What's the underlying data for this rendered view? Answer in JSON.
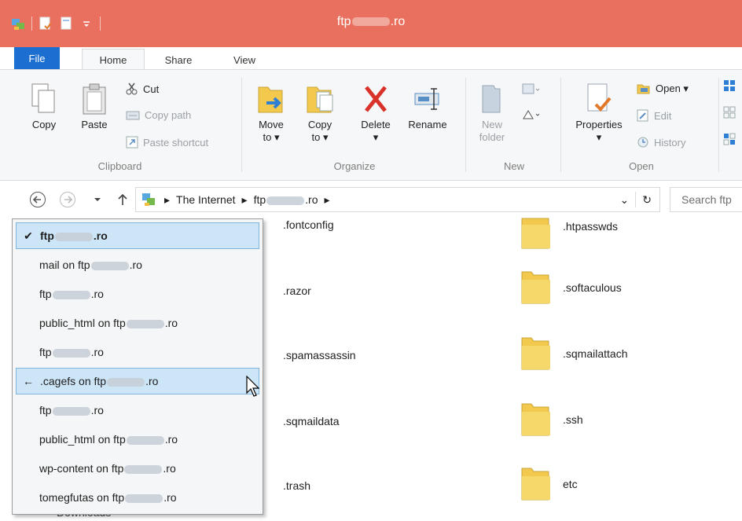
{
  "window": {
    "title_prefix": "ftp",
    "title_suffix": ".ro"
  },
  "ribbon_tabs": [
    "File",
    "Home",
    "Share",
    "View"
  ],
  "groups": {
    "clipboard": {
      "label": "Clipboard",
      "copy": "Copy",
      "paste": "Paste",
      "cut": "Cut",
      "copy_path": "Copy path",
      "paste_shortcut": "Paste shortcut"
    },
    "organize": {
      "label": "Organize",
      "move_to_1": "Move",
      "move_to_2": "to",
      "copy_to_1": "Copy",
      "copy_to_2": "to",
      "delete": "Delete",
      "rename": "Rename"
    },
    "new": {
      "label": "New",
      "new_folder_1": "New",
      "new_folder_2": "folder"
    },
    "open": {
      "label": "Open",
      "properties": "Properties",
      "open": "Open",
      "edit": "Edit",
      "history": "History"
    }
  },
  "address": {
    "crumb_1": "The Internet",
    "crumb_2_prefix": "ftp",
    "crumb_2_suffix": ".ro",
    "search_placeholder": "Search ftp"
  },
  "history_menu": [
    {
      "mark": "✔",
      "prefix": "ftp",
      "suffix": ".ro",
      "bold": true,
      "selected": true
    },
    {
      "mark": "",
      "prefix": "mail on ftp",
      "suffix": ".ro",
      "bold": false,
      "selected": false
    },
    {
      "mark": "",
      "prefix": "ftp",
      "suffix": ".ro",
      "bold": false,
      "selected": false
    },
    {
      "mark": "",
      "prefix": "public_html on ftp",
      "suffix": ".ro",
      "bold": false,
      "selected": false
    },
    {
      "mark": "",
      "prefix": "ftp",
      "suffix": ".ro",
      "bold": false,
      "selected": false
    },
    {
      "mark": "←",
      "prefix": ".cagefs on ftp",
      "suffix": ".ro",
      "bold": false,
      "selected": true
    },
    {
      "mark": "",
      "prefix": "ftp",
      "suffix": ".ro",
      "bold": false,
      "selected": false
    },
    {
      "mark": "",
      "prefix": "public_html on ftp",
      "suffix": ".ro",
      "bold": false,
      "selected": false
    },
    {
      "mark": "",
      "prefix": "wp-content on ftp",
      "suffix": ".ro",
      "bold": false,
      "selected": false
    },
    {
      "mark": "",
      "prefix": "tomegfutas on ftp",
      "suffix": ".ro",
      "bold": false,
      "selected": false
    }
  ],
  "files_col1": [
    ".fontconfig",
    ".razor",
    ".spamassassin",
    ".sqmaildata",
    ".trash"
  ],
  "files_col2": [
    ".htpasswds",
    ".softaculous",
    ".sqmailattach",
    ".ssh",
    "etc"
  ],
  "left_pane_peek": "Downloads",
  "colors": {
    "titlebar": "#e9705e",
    "file_tab": "#1c6fd0",
    "selection": "#cde6f7",
    "folder": "#f2c94c"
  }
}
